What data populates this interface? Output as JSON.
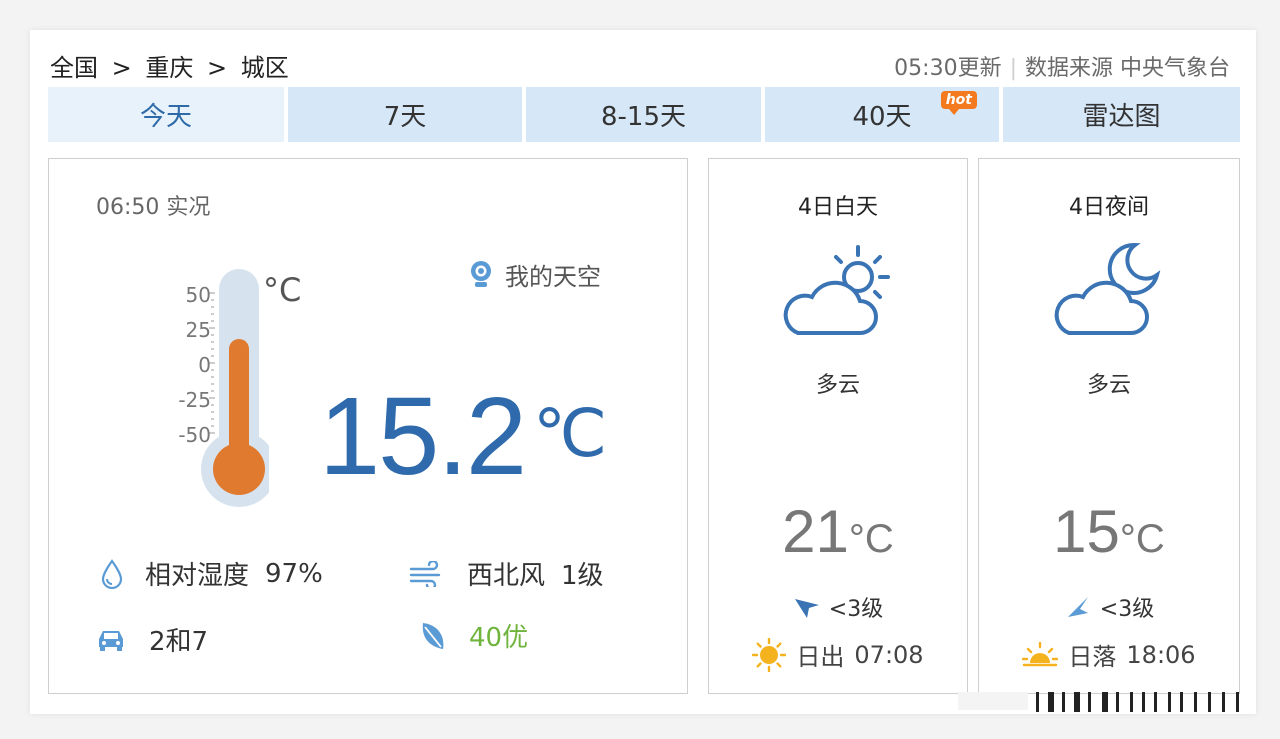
{
  "breadcrumb": [
    "全国",
    ">",
    "重庆",
    ">",
    "城区"
  ],
  "header": {
    "updated": "05:30更新",
    "source": "数据来源 中央气象台"
  },
  "tabs": [
    {
      "label": "今天",
      "active": true
    },
    {
      "label": "7天"
    },
    {
      "label": "8-15天"
    },
    {
      "label": "40天",
      "badge": "hot"
    },
    {
      "label": "雷达图"
    }
  ],
  "current": {
    "obs_time": "06:50 实况",
    "my_sky": "我的天空",
    "thermometer_scale": [
      "50",
      "25",
      "0",
      "-25",
      "-50"
    ],
    "thermometer_unit": "°C",
    "temperature": "15.2",
    "temp_unit": "℃",
    "humidity_label": "相对湿度",
    "humidity_value": "97%",
    "wind": "西北风",
    "wind_level": "1级",
    "traffic": "2和7",
    "aqi": "40优"
  },
  "day": {
    "title": "4日白天",
    "icon": "partly-cloudy-day-icon",
    "desc": "多云",
    "temp": "21",
    "unit": "°C",
    "wind": "<3级",
    "sun_label": "日出",
    "sun_time": "07:08"
  },
  "night": {
    "title": "4日夜间",
    "icon": "partly-cloudy-night-icon",
    "desc": "多云",
    "temp": "15",
    "unit": "°C",
    "wind": "<3级",
    "sun_label": "日落",
    "sun_time": "18:06"
  },
  "colors": {
    "accent": "#2f6aac",
    "tab": "#d6e7f7",
    "aqi_good": "#6fb43c",
    "mercury": "#e07a2e",
    "sun": "#f5b21f"
  }
}
